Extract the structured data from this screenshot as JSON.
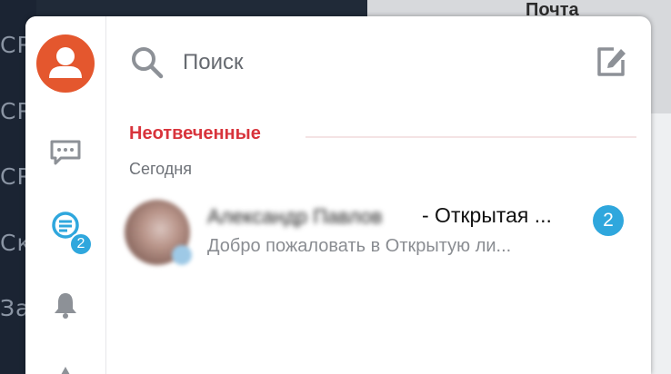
{
  "background": {
    "left_fragments": [
      "CR",
      "CR",
      "CR",
      "Ск",
      "За"
    ],
    "right_title": "Почта"
  },
  "sidebar": {
    "unread_count": "2",
    "icons": [
      "user-avatar-icon",
      "chat-icon",
      "discussions-icon",
      "bell-icon",
      "more-icon"
    ]
  },
  "search": {
    "placeholder": "Поиск"
  },
  "section": {
    "header": "Неотвеченные",
    "date": "Сегодня"
  },
  "conversation": {
    "sender": "Александр Павлов",
    "title": "- Открытая ...",
    "preview": "Добро пожаловать в Открытую ли...",
    "unread": "2"
  },
  "colors": {
    "accent": "#2fa7dd",
    "header_red": "#d8343c",
    "avatar_bg": "#e4572e"
  }
}
